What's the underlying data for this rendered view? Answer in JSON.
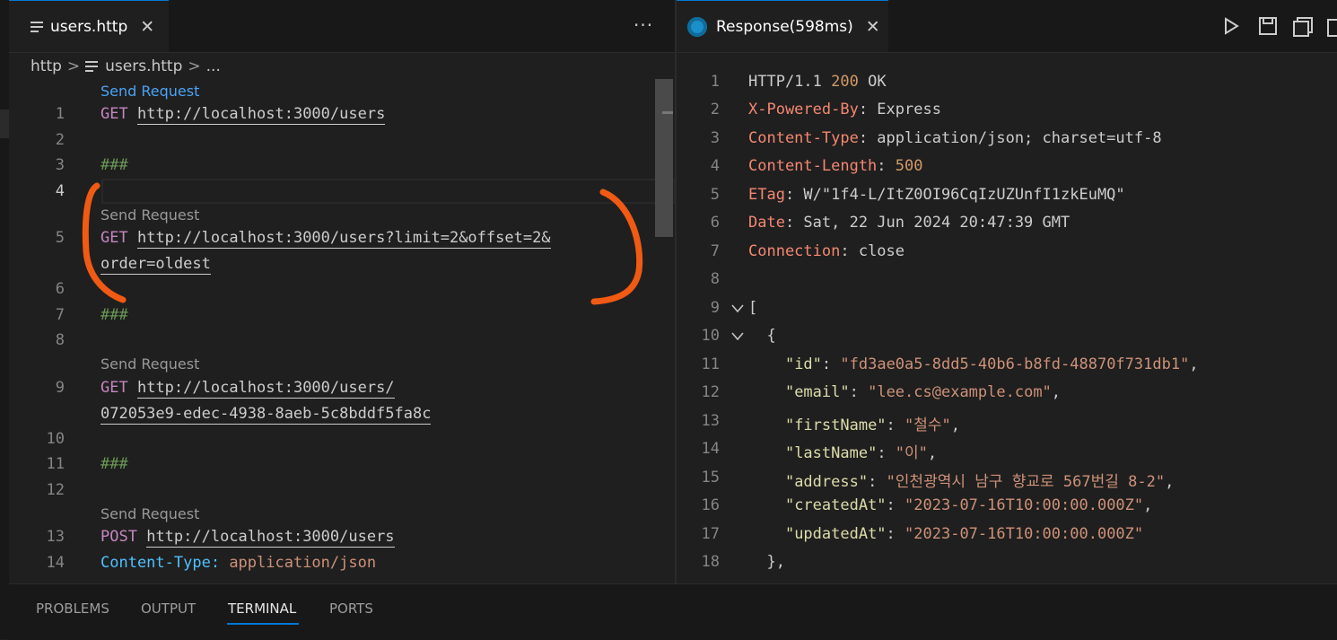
{
  "left_editor": {
    "tab": {
      "label": "users.http",
      "close": "✕"
    },
    "more": "···",
    "breadcrumb": {
      "folder": "http",
      "sep1": ">",
      "file": "users.http",
      "sep2": ">",
      "rest": "..."
    },
    "codelens": [
      "Send Request",
      "Send Request",
      "Send Request",
      "Send Request"
    ],
    "lines": [
      {
        "n": "1",
        "method": "GET",
        "url": "http://localhost:3000/users"
      },
      {
        "n": "2"
      },
      {
        "n": "3",
        "text": "###"
      },
      {
        "n": "4"
      },
      {
        "n": "5",
        "method": "GET",
        "url": "http://localhost:3000/users?limit=2&offset=2&",
        "wrap": "order=oldest"
      },
      {
        "n": "6"
      },
      {
        "n": "7",
        "text": "###"
      },
      {
        "n": "8"
      },
      {
        "n": "9",
        "method": "GET",
        "url": "http://localhost:3000/users/",
        "wrap": "072053e9-edec-4938-8aeb-5c8bddf5fa8c"
      },
      {
        "n": "10"
      },
      {
        "n": "11",
        "text": "###"
      },
      {
        "n": "12"
      },
      {
        "n": "13",
        "method": "POST",
        "url": "http://localhost:3000/users"
      },
      {
        "n": "14",
        "key": "Content-Type:",
        "value": "application/json"
      }
    ],
    "annotation_color": "#f05a14"
  },
  "right_editor": {
    "tab": {
      "label": "Response(598ms)",
      "close": "✕"
    },
    "lines": [
      {
        "n": "1",
        "a": "HTTP/1.1 ",
        "b": "200",
        "c": " OK"
      },
      {
        "n": "2",
        "k": "X-Powered-By",
        "v": ": Express"
      },
      {
        "n": "3",
        "k": "Content-Type",
        "v": ": application/json; charset=utf-8"
      },
      {
        "n": "4",
        "k": "Content-Length",
        "v": ": ",
        "num": "500"
      },
      {
        "n": "5",
        "k": "ETag",
        "v": ": W/\"1f4-L/ItZ0OI96CqIzUZUnfI1zkEuMQ\""
      },
      {
        "n": "6",
        "k": "Date",
        "v": ": Sat, 22 Jun 2024 20:47:39 GMT"
      },
      {
        "n": "7",
        "k": "Connection",
        "v": ": close"
      },
      {
        "n": "8"
      },
      {
        "n": "9",
        "text": "["
      },
      {
        "n": "10",
        "text": "  {"
      },
      {
        "n": "11",
        "jk": "\"id\"",
        "jv": "\"fd3ae0a5-8dd5-40b6-b8fd-48870f731db1\"",
        "end": ","
      },
      {
        "n": "12",
        "jk": "\"email\"",
        "jv": "\"lee.cs@example.com\"",
        "end": ","
      },
      {
        "n": "13",
        "jk": "\"firstName\"",
        "jv": "\"철수\"",
        "end": ","
      },
      {
        "n": "14",
        "jk": "\"lastName\"",
        "jv": "\"이\"",
        "end": ","
      },
      {
        "n": "15",
        "jk": "\"address\"",
        "jv": "\"인천광역시 남구 향교로 567번길 8-2\"",
        "end": ","
      },
      {
        "n": "16",
        "jk": "\"createdAt\"",
        "jv": "\"2023-07-16T10:00:00.000Z\"",
        "end": ","
      },
      {
        "n": "17",
        "jk": "\"updatedAt\"",
        "jv": "\"2023-07-16T10:00:00.000Z\"",
        "end": ""
      },
      {
        "n": "18",
        "text": "  },"
      }
    ]
  },
  "panel": {
    "tabs": [
      "PROBLEMS",
      "OUTPUT",
      "TERMINAL",
      "PORTS"
    ],
    "active": "TERMINAL"
  }
}
